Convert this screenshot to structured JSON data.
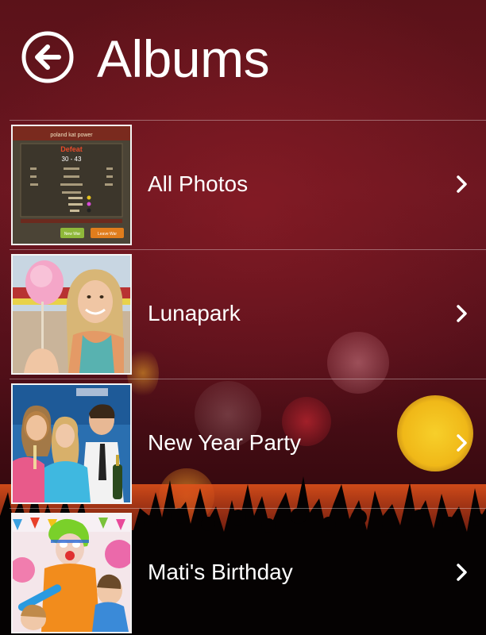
{
  "header": {
    "title": "Albums",
    "back_icon": "back-arrow-circle-icon"
  },
  "albums": [
    {
      "name": "All Photos",
      "thumbnail": "game-defeat-screen"
    },
    {
      "name": "Lunapark",
      "thumbnail": "girl-with-cotton-candy"
    },
    {
      "name": "New Year Party",
      "thumbnail": "friends-with-champagne"
    },
    {
      "name": "Mati's Birthday",
      "thumbnail": "clown-party"
    }
  ],
  "thumbnail_text": {
    "game_title": "poland  kat power",
    "result": "Defeat",
    "score": "30 - 43",
    "retry_label": "New War",
    "leave_label": "Leave War"
  },
  "colors": {
    "background": "#5b1219",
    "text": "#ffffff",
    "bokeh_yellow": "#f2c21a"
  }
}
